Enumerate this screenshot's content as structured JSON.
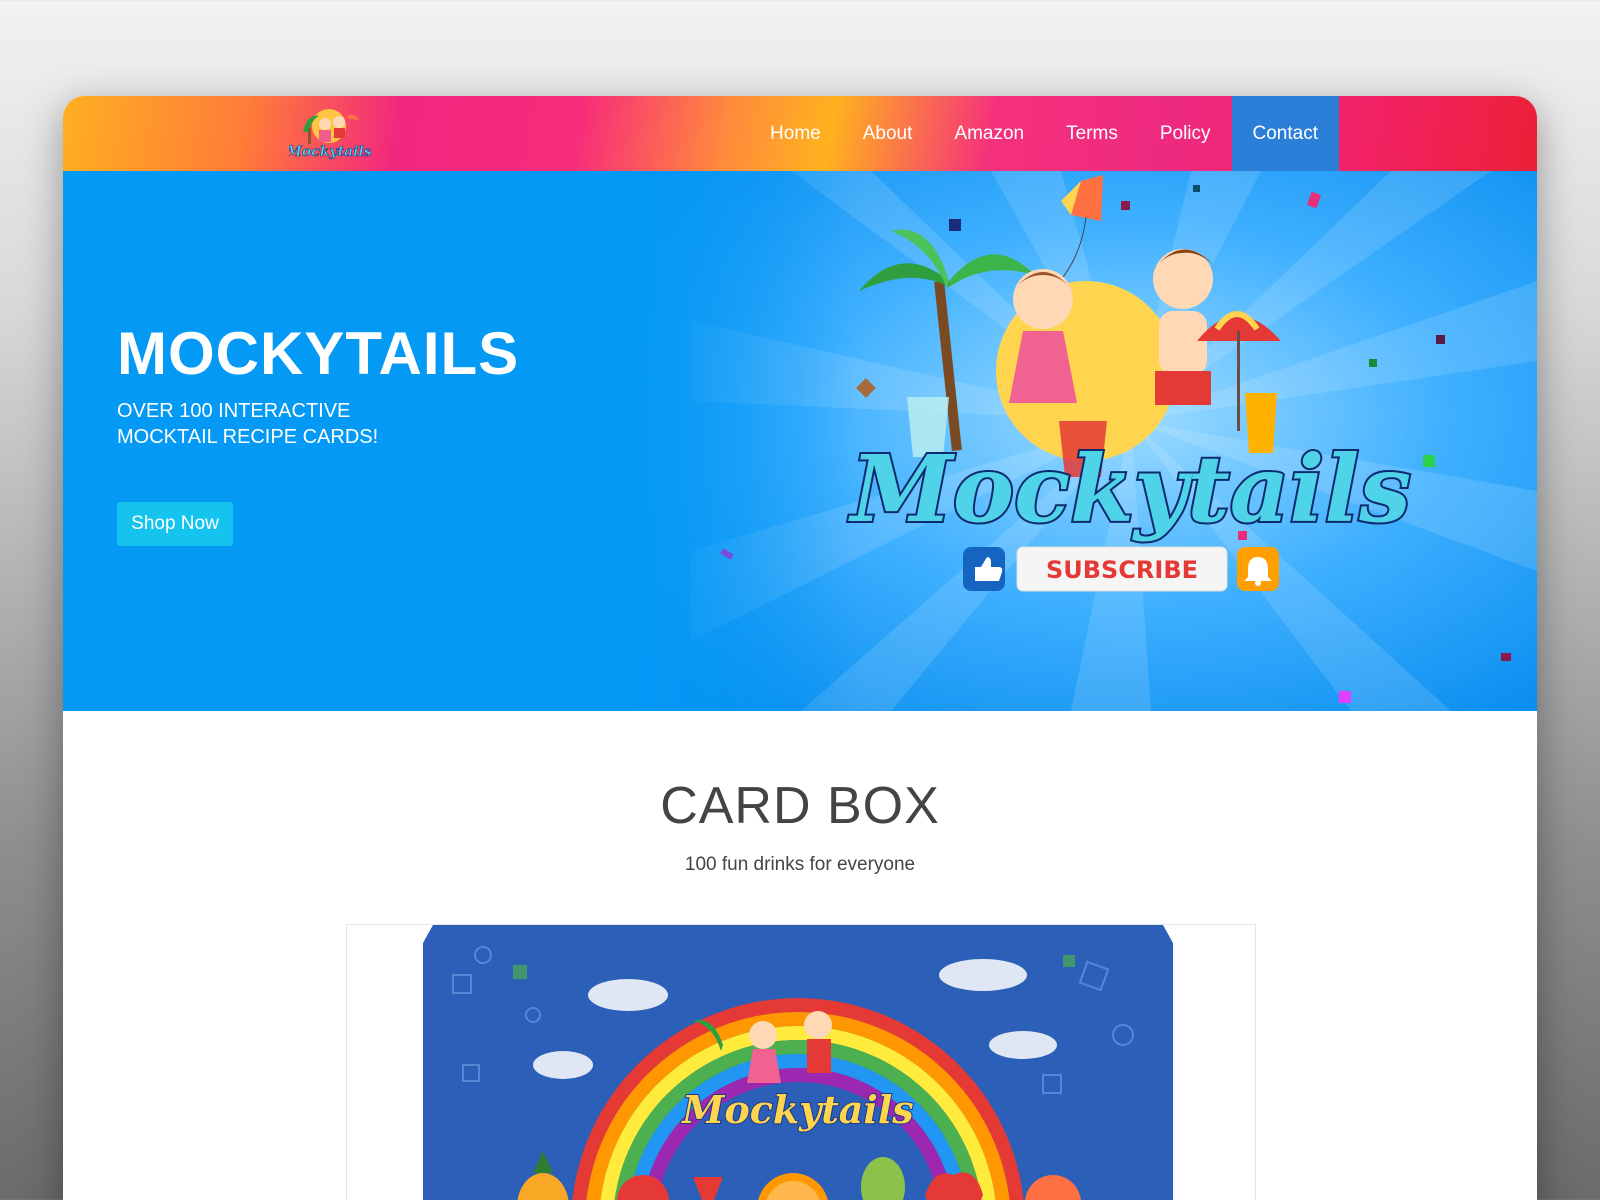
{
  "nav": {
    "logo_text": "Mockytails",
    "links": [
      {
        "label": "Home"
      },
      {
        "label": "About"
      },
      {
        "label": "Amazon"
      },
      {
        "label": "Terms"
      },
      {
        "label": "Policy"
      },
      {
        "label": "Contact",
        "active": true
      }
    ]
  },
  "hero": {
    "title": "MOCKYTAILS",
    "subtitle_line1": "OVER 100 INTERACTIVE",
    "subtitle_line2": "MOCKTAIL RECIPE CARDS!",
    "cta_label": "Shop Now",
    "banner_logo_text": "Mockytails",
    "subscribe_label": "SUBSCRIBE"
  },
  "card_box": {
    "title": "CARD BOX",
    "subtitle": "100 fun drinks for everyone",
    "box_logo_text": "Mockytails"
  },
  "colors": {
    "hero_bg": "#0399f5",
    "nav_active": "#2b7fd9",
    "cta_bg": "#14c4ef",
    "subscribe_red": "#e53935"
  }
}
